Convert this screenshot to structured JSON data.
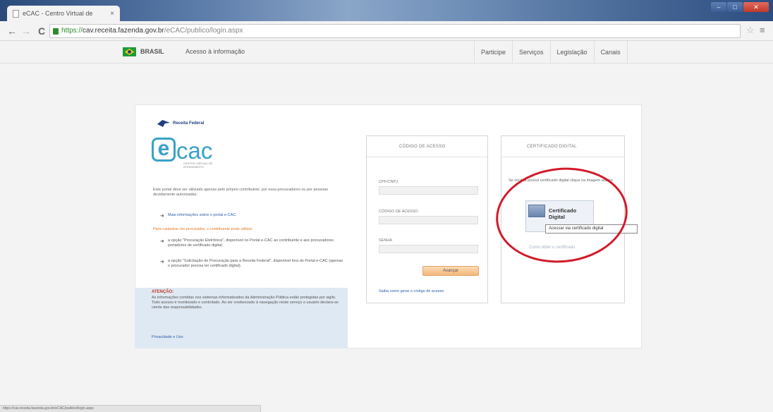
{
  "browser": {
    "tab_title": "eCAC - Centro Virtual de",
    "tab_close": "×",
    "url_https": "https://",
    "url_host": "cav.receita.fazenda.gov.br",
    "url_path": "/eCAC/publico/login.aspx",
    "back": "←",
    "forward": "→",
    "reload": "C",
    "star": "☆",
    "menu": "≡",
    "win_minimize": "–",
    "win_maximize": "□",
    "win_close": "✕"
  },
  "govbar": {
    "brasil": "BRASIL",
    "access_info": "Acesso à informação",
    "menu": [
      "Participe",
      "Serviços",
      "Legislação",
      "Canais"
    ]
  },
  "left": {
    "rf_name": "Receita Federal",
    "ecac_e": "e",
    "ecac_rest": "cac",
    "ecac_sub": "CENTRO VIRTUAL DE ATENDIMENTO",
    "intro": "Este portal deve ser utilizado apenas pelo próprio contribuinte, por essa procuradores ou por pessoas devidamente autorizadas.",
    "bullet_mark": "➜",
    "info_link": "Mais informações sobre o portal e-CAC",
    "orange_line": "Para cadastrar um procurador, o contribuinte pode utilizar:",
    "option1": "a opção \"Procuração Eletrônica\", disponível no Portal e-CAC ao contribuinte e aos procuradores portadores de certificado digital;",
    "option2": "a opção \"Solicitação de Procuração para a Receita Federal\", disponível fora do Portal e-CAC (apenas o procurador precisa ter certificado digital).",
    "attention_title": "ATENÇÃO:",
    "attention_text": "As informações contidas nos sistemas informatizados da Administração Pública estão protegidas por sigilo. Todo acesso é monitorado e controlado. Ao ser credenciado à navegação neste serviço o usuário declara-se ciente das responsabilidades",
    "privacy_link": "Privacidade e Uso"
  },
  "access": {
    "title": "CÓDIGO DE ACESSO",
    "cpf_label": "CPF/CNPJ",
    "code_label": "CÓDIGO DE ACESSO",
    "password_label": "SENHA",
    "submit": "Avançar",
    "know_link": "Saiba como gerar o código de acesso"
  },
  "cert": {
    "title": "CERTIFICADO DIGITAL",
    "text": "Se você já possui certificado digital clique na imagem abaixo",
    "button_label": "Certificado Digital",
    "tooltip": "Acessar via certificado digital",
    "howto_link": "Como obter o certificado"
  },
  "status": {
    "text": "https://cav.receita.fazenda.gov.br/eCAC/publico/login.aspx"
  },
  "colors": {
    "accent": "#39a1c9",
    "link": "#2c5ea8",
    "highlight_ring": "#d21a2a",
    "submit_button": "#f5b77c"
  }
}
